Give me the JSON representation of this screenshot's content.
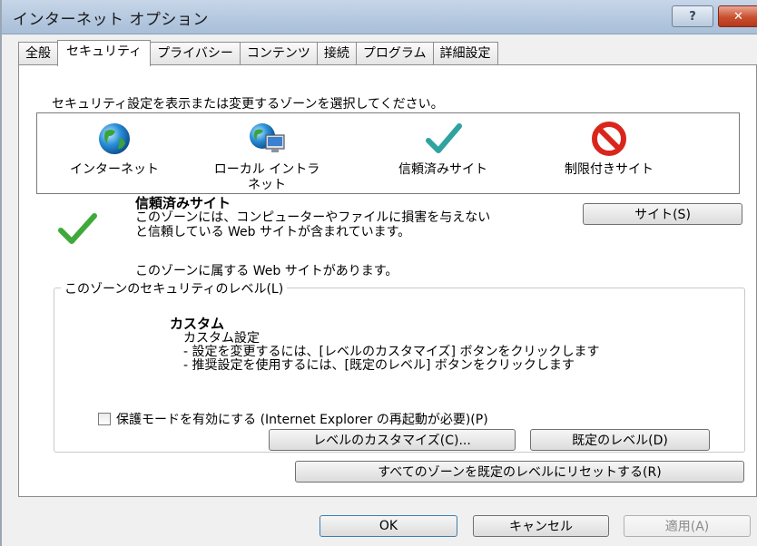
{
  "window": {
    "title": "インターネット オプション",
    "help_label": "?",
    "close_label": "✕"
  },
  "tabs": [
    {
      "label": "全般"
    },
    {
      "label": "セキュリティ",
      "active": true
    },
    {
      "label": "プライバシー"
    },
    {
      "label": "コンテンツ"
    },
    {
      "label": "接続"
    },
    {
      "label": "プログラム"
    },
    {
      "label": "詳細設定"
    }
  ],
  "security": {
    "instruction": "セキュリティ設定を表示または変更するゾーンを選択してください。",
    "zones": [
      {
        "label": "インターネット",
        "icon": "globe-icon"
      },
      {
        "label": "ローカル イントラネット",
        "icon": "intranet-icon"
      },
      {
        "label": "信頼済みサイト",
        "icon": "checkmark-icon",
        "selected": true
      },
      {
        "label": "制限付きサイト",
        "icon": "prohibited-icon"
      }
    ],
    "zone_heading": "信頼済みサイト",
    "zone_desc_line1": "このゾーンには、コンピューターやファイルに損害を与えない",
    "zone_desc_line2": "と信頼している Web サイトが含まれています。",
    "zone_status": "このゾーンに属する Web サイトがあります。",
    "sites_button": "サイト(S)",
    "group_title": "このゾーンのセキュリティのレベル(L)",
    "level_title": "カスタム",
    "level_lines": [
      "カスタム設定",
      "- 設定を変更するには、[レベルのカスタマイズ] ボタンをクリックします",
      "- 推奨設定を使用するには、[既定のレベル] ボタンをクリックします"
    ],
    "protected_mode_label": "保護モードを有効にする (Internet Explorer の再起動が必要)(P)",
    "protected_mode_checked": false,
    "custom_level_button": "レベルのカスタマイズ(C)...",
    "default_level_button": "既定のレベル(D)",
    "reset_all_button": "すべてのゾーンを既定のレベルにリセットする(R)"
  },
  "footer": {
    "ok": "OK",
    "cancel": "キャンセル",
    "apply": "適用(A)"
  },
  "colors": {
    "selection": "#3399ff",
    "check_green": "#3fa93a",
    "prohibited_red": "#d9261c"
  }
}
